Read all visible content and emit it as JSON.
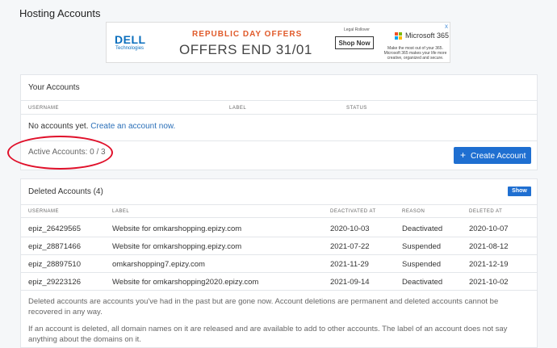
{
  "page": {
    "title": "Hosting Accounts"
  },
  "ad": {
    "close": "x",
    "dell_logo": "DELL",
    "dell_sub": "Technologies",
    "headline": "REPUBLIC DAY OFFERS",
    "offer": "OFFERS END 31/01",
    "legal": "Legal Rollover",
    "shop_label": "Shop Now",
    "ms_name": "Microsoft 365",
    "ms_desc": "Make the most out of your 365. Microsoft 365 makes your life more creative, organized and secure.",
    "colors": {
      "ms_red": "#f25022",
      "ms_green": "#7fba00",
      "ms_blue": "#00a4ef",
      "ms_yellow": "#ffb900"
    }
  },
  "your_accounts": {
    "title": "Your Accounts",
    "columns": [
      "USERNAME",
      "LABEL",
      "STATUS"
    ],
    "empty_text": "No accounts yet.",
    "create_link": "Create an account now.",
    "active_label": "Active Accounts: 0 / 3",
    "create_button": "Create Account",
    "plus": "+"
  },
  "deleted_accounts": {
    "title": "Deleted Accounts (4)",
    "show_button": "Show",
    "columns": [
      "USERNAME",
      "LABEL",
      "DEACTIVATED AT",
      "REASON",
      "DELETED AT"
    ],
    "rows": [
      {
        "username": "epiz_26429565",
        "label": "Website for omkarshopping.epizy.com",
        "deactivated": "2020-10-03",
        "reason": "Deactivated",
        "deleted": "2020-10-07"
      },
      {
        "username": "epiz_28871466",
        "label": "Website for omkarshopping.epizy.com",
        "deactivated": "2021-07-22",
        "reason": "Suspended",
        "deleted": "2021-08-12"
      },
      {
        "username": "epiz_28897510",
        "label": "omkarshopping7.epizy.com",
        "deactivated": "2021-11-29",
        "reason": "Suspended",
        "deleted": "2021-12-19"
      },
      {
        "username": "epiz_29223126",
        "label": "Website for omkarshopping2020.epizy.com",
        "deactivated": "2021-09-14",
        "reason": "Deactivated",
        "deleted": "2021-10-02"
      }
    ],
    "note1": "Deleted accounts are accounts you've had in the past but are gone now. Account deletions are permanent and deleted accounts cannot be recovered in any way.",
    "note2": "If an account is deleted, all domain names on it are released and are available to add to other accounts. The label of an account does not say anything about the domains on it."
  },
  "annotation": {
    "color": "#e0102a"
  }
}
